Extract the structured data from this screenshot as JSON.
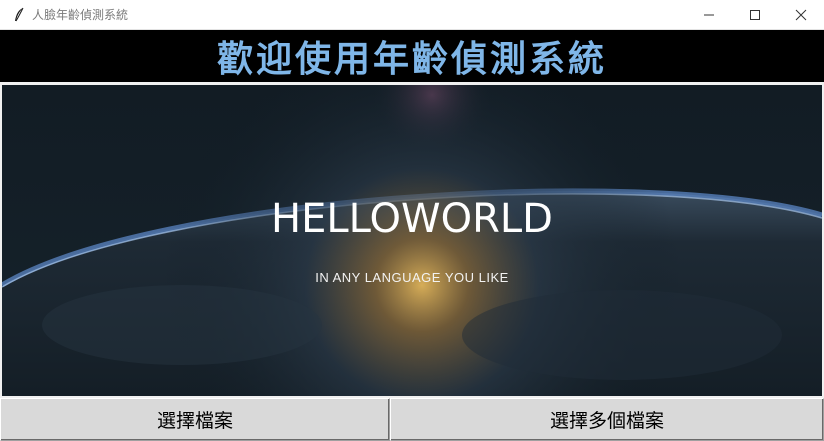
{
  "window": {
    "title": "人臉年齡偵測系統",
    "icon": "feather-icon",
    "controls": [
      "minimize-icon",
      "maximize-icon",
      "close-icon"
    ]
  },
  "banner": {
    "title": "歡迎使用年齡偵測系統",
    "color": "#7fb6e8",
    "background": "#000000"
  },
  "image": {
    "headline": "HELLOWORLD",
    "tagline": "IN ANY LANGUAGE YOU LIKE",
    "description_colors": {
      "space": "#0f1a22",
      "glow": "#d9b060",
      "atmosphere": "#4f79b8"
    }
  },
  "buttons": {
    "select_file": "選擇檔案",
    "select_multiple": "選擇多個檔案"
  }
}
